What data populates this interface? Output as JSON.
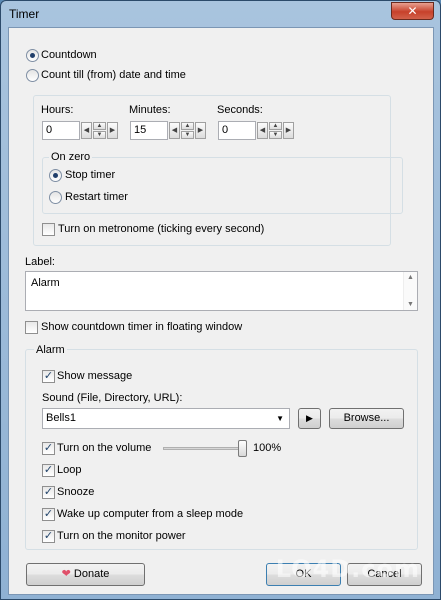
{
  "window": {
    "title": "Timer",
    "close_glyph": "✕"
  },
  "mode": {
    "countdown": "Countdown",
    "count_till": "Count till (from) date and time"
  },
  "time": {
    "hours_label": "Hours:",
    "minutes_label": "Minutes:",
    "seconds_label": "Seconds:",
    "hours": "0",
    "minutes": "15",
    "seconds": "0"
  },
  "on_zero": {
    "title": "On zero",
    "stop": "Stop timer",
    "restart": "Restart timer"
  },
  "metronome": "Turn on metronome (ticking every second)",
  "label": {
    "caption": "Label:",
    "value": "Alarm"
  },
  "floating": "Show countdown timer in floating window",
  "alarm": {
    "title": "Alarm",
    "show_message": "Show message",
    "sound_caption": "Sound (File, Directory, URL):",
    "sound_value": "Bells1",
    "browse": "Browse...",
    "volume": "Turn on the volume",
    "volume_value": "100%",
    "volume_level": 100,
    "loop": "Loop",
    "snooze": "Snooze",
    "wake": "Wake up computer from a sleep mode",
    "monitor": "Turn on the monitor power"
  },
  "footer": {
    "donate": "Donate",
    "ok": "OK",
    "cancel": "Cancel"
  },
  "glyphs": {
    "check": "✓",
    "left": "◀",
    "right": "▶",
    "up": "▲",
    "down": "▼",
    "heart": "❤"
  },
  "watermark": "LO4D.com",
  "colors": {
    "titlebar": "#a9c4de",
    "close": "#c7412b",
    "dialog_bg": "#f0f0f0"
  }
}
